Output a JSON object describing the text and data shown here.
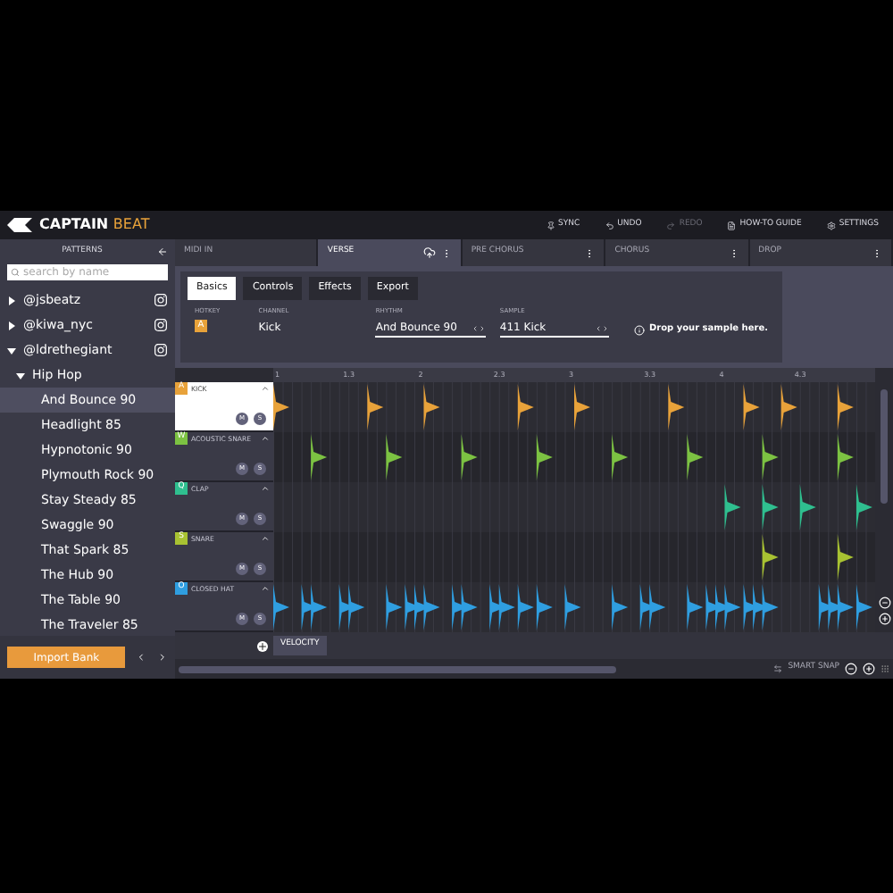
{
  "header": {
    "logo_first": "CAPTAIN",
    "logo_second": "BEAT",
    "actions": [
      {
        "kind": "sync",
        "label": "SYNC",
        "disabled": false
      },
      {
        "kind": "undo",
        "label": "UNDO",
        "disabled": false
      },
      {
        "kind": "redo",
        "label": "REDO",
        "disabled": true
      },
      {
        "kind": "guide",
        "label": "HOW-TO GUIDE",
        "disabled": false
      },
      {
        "kind": "settings",
        "label": "SETTINGS",
        "disabled": false
      }
    ]
  },
  "sidebar": {
    "title": "PATTERNS",
    "search": {
      "placeholder": "search by name"
    },
    "users": [
      {
        "name": "@jsbeatz",
        "expanded": false
      },
      {
        "name": "@kiwa_nyc",
        "expanded": false
      },
      {
        "name": "@ldrethegiant",
        "expanded": true,
        "children": [
          {
            "name": "Hip Hop",
            "expanded": true,
            "children": [
              {
                "name": "And Bounce 90",
                "selected": true
              },
              {
                "name": "Headlight 85",
                "selected": false
              },
              {
                "name": "Hypnotonic 90",
                "selected": false
              },
              {
                "name": "Plymouth Rock 90",
                "selected": false
              },
              {
                "name": "Stay Steady 85",
                "selected": false
              },
              {
                "name": "Swaggle 90",
                "selected": false
              },
              {
                "name": "That Spark 85",
                "selected": false
              },
              {
                "name": "The Hub 90",
                "selected": false
              },
              {
                "name": "The Table 90",
                "selected": false
              },
              {
                "name": "The Traveler 85",
                "selected": false
              }
            ]
          }
        ]
      }
    ],
    "import_button": "Import Bank"
  },
  "sections": [
    {
      "label": "MIDI IN",
      "selected": false,
      "menu": false
    },
    {
      "label": "VERSE",
      "selected": true,
      "menu": true
    },
    {
      "label": "PRE CHORUS",
      "selected": false,
      "menu": true
    },
    {
      "label": "CHORUS",
      "selected": false,
      "menu": true
    },
    {
      "label": "DROP",
      "selected": false,
      "menu": true
    }
  ],
  "panel_tabs": [
    {
      "label": "Basics",
      "selected": true
    },
    {
      "label": "Controls",
      "selected": false
    },
    {
      "label": "Effects",
      "selected": false
    },
    {
      "label": "Export",
      "selected": false
    }
  ],
  "fields": {
    "hotkey": {
      "label": "HOTKEY",
      "value": "A"
    },
    "channel": {
      "label": "CHANNEL",
      "value": "Kick"
    },
    "rhythm": {
      "label": "RHYTHM",
      "value": "And Bounce 90"
    },
    "sample": {
      "label": "SAMPLE",
      "value": "411 Kick"
    },
    "drop_hint": "Drop your sample here."
  },
  "ruler": [
    "1",
    "1.3",
    "2",
    "2.3",
    "3",
    "3.3",
    "4",
    "4.3"
  ],
  "tracks": [
    {
      "key": "A",
      "name": "KICK",
      "color": "#e8a23a",
      "selected": true,
      "mute": "M",
      "solo": "S",
      "steps": [
        true,
        false,
        false,
        false,
        false,
        false,
        false,
        false,
        false,
        false,
        true,
        false,
        false,
        false,
        false,
        false,
        true,
        false,
        false,
        false,
        false,
        false,
        false,
        false,
        false,
        false,
        true,
        false,
        false,
        false,
        false,
        false,
        true,
        false,
        false,
        false,
        false,
        false,
        false,
        false,
        false,
        false,
        true,
        false,
        false,
        false,
        false,
        false,
        false,
        false,
        true,
        false,
        false,
        false,
        true,
        false,
        false,
        false,
        false,
        false,
        true,
        false,
        false,
        false
      ]
    },
    {
      "key": "W",
      "name": "ACOUSTIC SNARE",
      "color": "#7cc242",
      "selected": false,
      "mute": "M",
      "solo": "S",
      "steps": [
        false,
        false,
        false,
        false,
        true,
        false,
        false,
        false,
        false,
        false,
        false,
        false,
        true,
        false,
        false,
        false,
        false,
        false,
        false,
        false,
        true,
        false,
        false,
        false,
        false,
        false,
        false,
        false,
        true,
        false,
        false,
        false,
        false,
        false,
        false,
        false,
        true,
        false,
        false,
        false,
        false,
        false,
        false,
        false,
        true,
        false,
        false,
        false,
        false,
        false,
        false,
        false,
        true,
        false,
        false,
        false,
        false,
        false,
        false,
        false,
        true,
        false,
        false,
        false
      ]
    },
    {
      "key": "Q",
      "name": "CLAP",
      "color": "#2fbf8f",
      "selected": false,
      "mute": "M",
      "solo": "S",
      "steps": [
        false,
        false,
        false,
        false,
        false,
        false,
        false,
        false,
        false,
        false,
        false,
        false,
        false,
        false,
        false,
        false,
        false,
        false,
        false,
        false,
        false,
        false,
        false,
        false,
        false,
        false,
        false,
        false,
        false,
        false,
        false,
        false,
        false,
        false,
        false,
        false,
        false,
        false,
        false,
        false,
        false,
        false,
        false,
        false,
        false,
        false,
        false,
        false,
        true,
        false,
        false,
        false,
        true,
        false,
        false,
        false,
        true,
        false,
        false,
        false,
        false,
        false,
        true,
        false
      ]
    },
    {
      "key": "S",
      "name": "SNARE",
      "color": "#a8c232",
      "selected": false,
      "mute": "M",
      "solo": "S",
      "steps": [
        false,
        false,
        false,
        false,
        false,
        false,
        false,
        false,
        false,
        false,
        false,
        false,
        false,
        false,
        false,
        false,
        false,
        false,
        false,
        false,
        false,
        false,
        false,
        false,
        false,
        false,
        false,
        false,
        false,
        false,
        false,
        false,
        false,
        false,
        false,
        false,
        false,
        false,
        false,
        false,
        false,
        false,
        false,
        false,
        false,
        false,
        false,
        false,
        false,
        false,
        false,
        false,
        true,
        false,
        false,
        false,
        false,
        false,
        false,
        false,
        true,
        false,
        false,
        false
      ]
    },
    {
      "key": "O",
      "name": "CLOSED HAT",
      "color": "#2f9ee0",
      "selected": false,
      "mute": "M",
      "solo": "S",
      "steps": [
        true,
        false,
        false,
        true,
        true,
        false,
        false,
        true,
        true,
        false,
        false,
        false,
        true,
        false,
        true,
        true,
        true,
        false,
        false,
        true,
        true,
        false,
        false,
        true,
        true,
        false,
        true,
        false,
        true,
        false,
        false,
        true,
        false,
        false,
        false,
        false,
        true,
        false,
        false,
        true,
        true,
        false,
        false,
        false,
        true,
        false,
        true,
        true,
        true,
        false,
        true,
        true,
        true,
        false,
        false,
        false,
        false,
        false,
        true,
        true,
        true,
        false,
        true,
        false
      ]
    }
  ],
  "bottom_tab": "VELOCITY",
  "smart_snap": "SMART SNAP"
}
